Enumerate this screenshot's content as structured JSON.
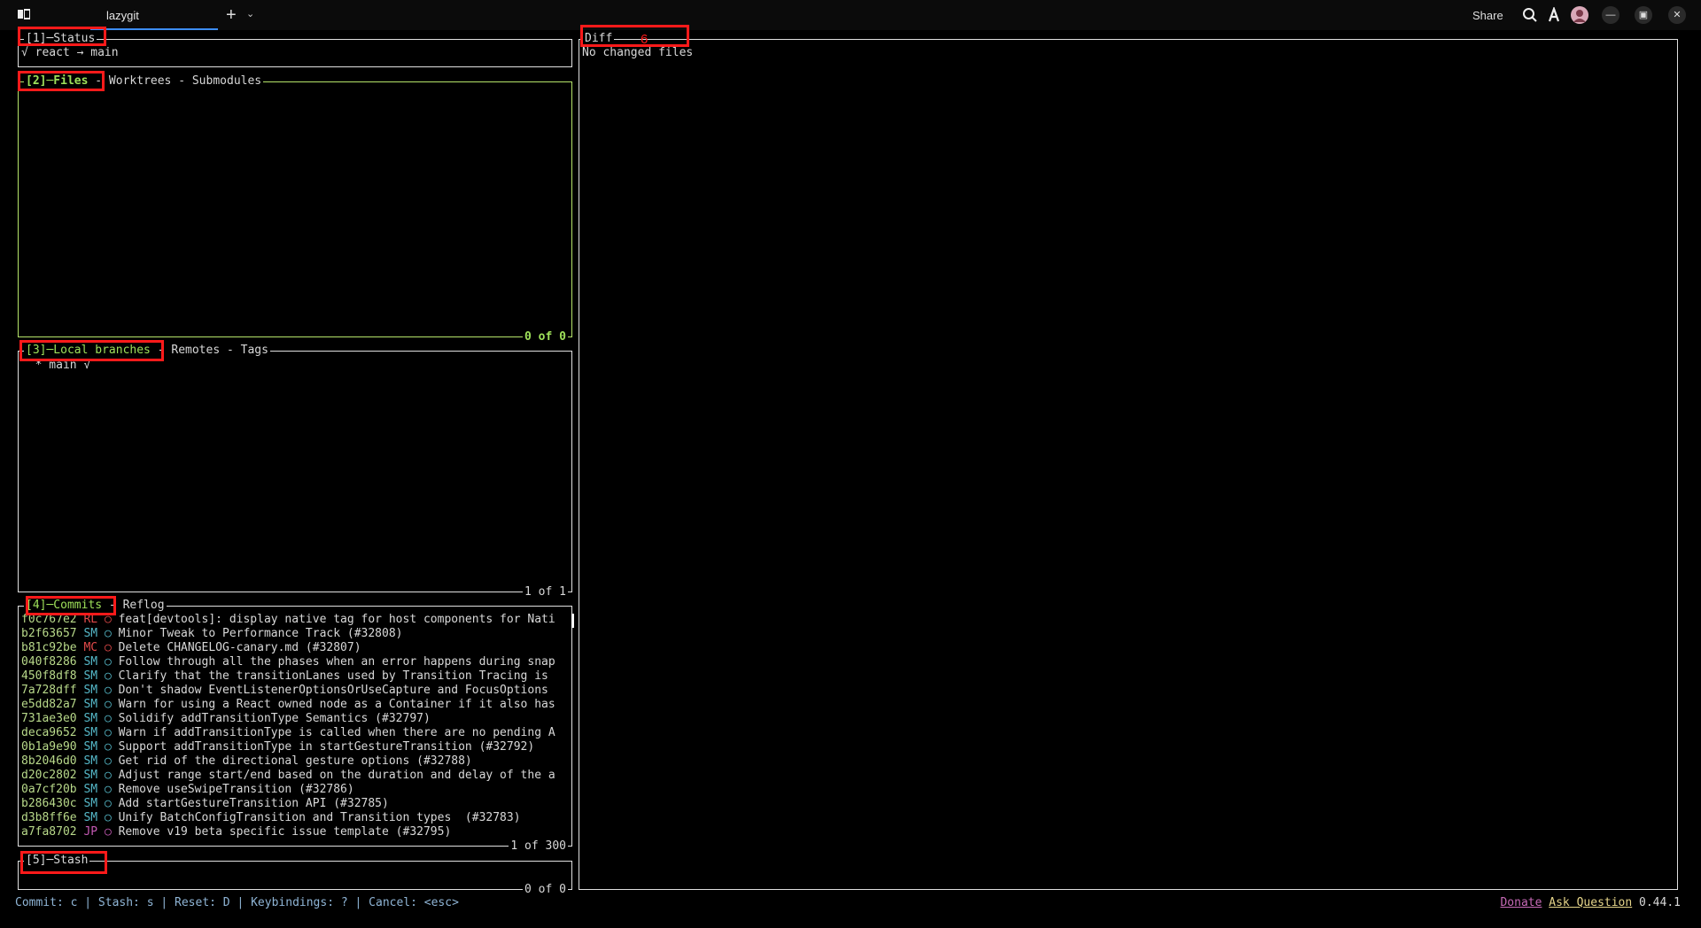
{
  "window": {
    "tab_label": "lazygit",
    "share_label": "Share",
    "icons": [
      "app-icon",
      "new-tab-icon",
      "tab-dropdown-icon",
      "search-icon",
      "font-icon",
      "avatar",
      "minimize-icon",
      "restore-icon",
      "close-icon"
    ],
    "plus": "+",
    "chevron": "⌄",
    "minimize": "—",
    "restore": "▣",
    "close": "✕"
  },
  "status": {
    "title": "[1]─Status",
    "line": "√ react → main"
  },
  "files": {
    "title_active": "[2]─Files",
    "title_rest": " - Worktrees - Submodules",
    "footer": "0 of 0"
  },
  "branches": {
    "title": "[3]─Local branches",
    "title_rest": " - Remotes - Tags",
    "items": [
      {
        "text": "  * main √"
      }
    ],
    "footer": "1 of 1"
  },
  "commits": {
    "title": "[4]─Commits",
    "title_rest": " - Reflog",
    "footer": "1 of 300",
    "rows": [
      {
        "hash": "f0c767e2",
        "author": "RL",
        "marker": "○",
        "message": "feat[devtools]: display native tag for host components for Nati"
      },
      {
        "hash": "b2f63657",
        "author": "SM",
        "marker": "○",
        "message": "Minor Tweak to Performance Track (#32808)"
      },
      {
        "hash": "b81c92be",
        "author": "MC",
        "marker": "○",
        "message": "Delete CHANGELOG-canary.md (#32807)"
      },
      {
        "hash": "040f8286",
        "author": "SM",
        "marker": "○",
        "message": "Follow through all the phases when an error happens during snap"
      },
      {
        "hash": "450f8df8",
        "author": "SM",
        "marker": "○",
        "message": "Clarify that the transitionLanes used by Transition Tracing is"
      },
      {
        "hash": "7a728dff",
        "author": "SM",
        "marker": "○",
        "message": "Don't shadow EventListenerOptionsOrUseCapture and FocusOptions"
      },
      {
        "hash": "e5dd82a7",
        "author": "SM",
        "marker": "○",
        "message": "Warn for using a React owned node as a Container if it also has"
      },
      {
        "hash": "731ae3e0",
        "author": "SM",
        "marker": "○",
        "message": "Solidify addTransitionType Semantics (#32797)"
      },
      {
        "hash": "deca9652",
        "author": "SM",
        "marker": "○",
        "message": "Warn if addTransitionType is called when there are no pending A"
      },
      {
        "hash": "0b1a9e90",
        "author": "SM",
        "marker": "○",
        "message": "Support addTransitionType in startGestureTransition (#32792)"
      },
      {
        "hash": "8b2046d0",
        "author": "SM",
        "marker": "○",
        "message": "Get rid of the directional gesture options (#32788)"
      },
      {
        "hash": "d20c2802",
        "author": "SM",
        "marker": "○",
        "message": "Adjust range start/end based on the duration and delay of the a"
      },
      {
        "hash": "0a7cf20b",
        "author": "SM",
        "marker": "○",
        "message": "Remove useSwipeTransition (#32786)"
      },
      {
        "hash": "b286430c",
        "author": "SM",
        "marker": "○",
        "message": "Add startGestureTransition API (#32785)"
      },
      {
        "hash": "d3b8ff6e",
        "author": "SM",
        "marker": "○",
        "message": "Unify BatchConfigTransition and Transition types  (#32783)"
      },
      {
        "hash": "a7fa8702",
        "author": "JP",
        "marker": "○",
        "message": "Remove v19 beta specific issue template (#32795)"
      }
    ]
  },
  "stash": {
    "title": "[5]─Stash",
    "footer": "0 of 0"
  },
  "diff": {
    "title": "Diff",
    "marker": "6",
    "body": "No changed files"
  },
  "bottom": {
    "keybindings": "Commit: c | Stash: s | Reset: D | Keybindings: ? | Cancel: <esc>",
    "donate": "Donate",
    "ask": "Ask Question",
    "version": "0.44.1"
  },
  "colors": {
    "active_border": "#b6e46a",
    "highlight_box": "#ff1a1a",
    "tab_underline": "#3d8df5"
  }
}
